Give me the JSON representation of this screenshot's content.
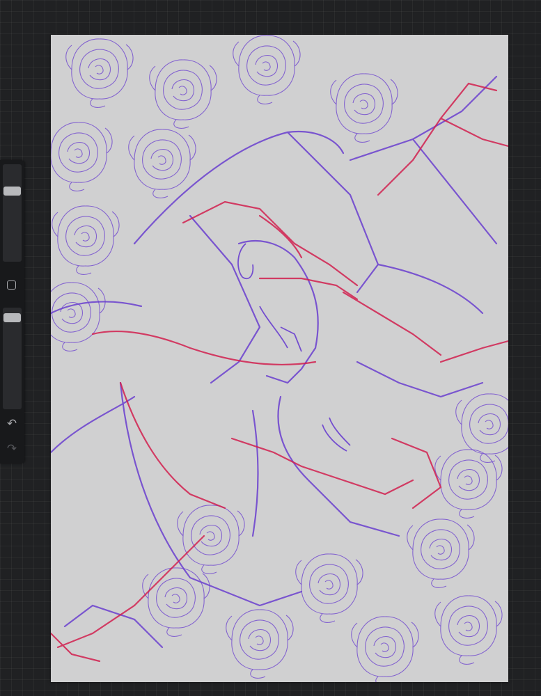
{
  "app": {
    "workspace": "procreate-canvas-view"
  },
  "sidebar": {
    "brush_size_slider": {
      "value_fraction": 0.75
    },
    "opacity_slider": {
      "value_fraction": 0.95
    },
    "modify_button_icon": "square-icon",
    "undo_icon": "undo-arrow-icon",
    "redo_icon": "redo-arrow-icon",
    "redo_enabled": false
  },
  "canvas": {
    "background_color": "#d0d0d1",
    "artwork": "sketch-illustration",
    "layers": [
      {
        "name_icon": "purple-sketch",
        "color": "#6a3fcf"
      },
      {
        "name_icon": "red-sketch",
        "color": "#d2204f"
      }
    ]
  },
  "colors": {
    "workspace_bg": "#202123",
    "sidebar_bg": "#18191b",
    "slider_thumb": "#b8b9bc",
    "icon": "#a9aaae"
  }
}
